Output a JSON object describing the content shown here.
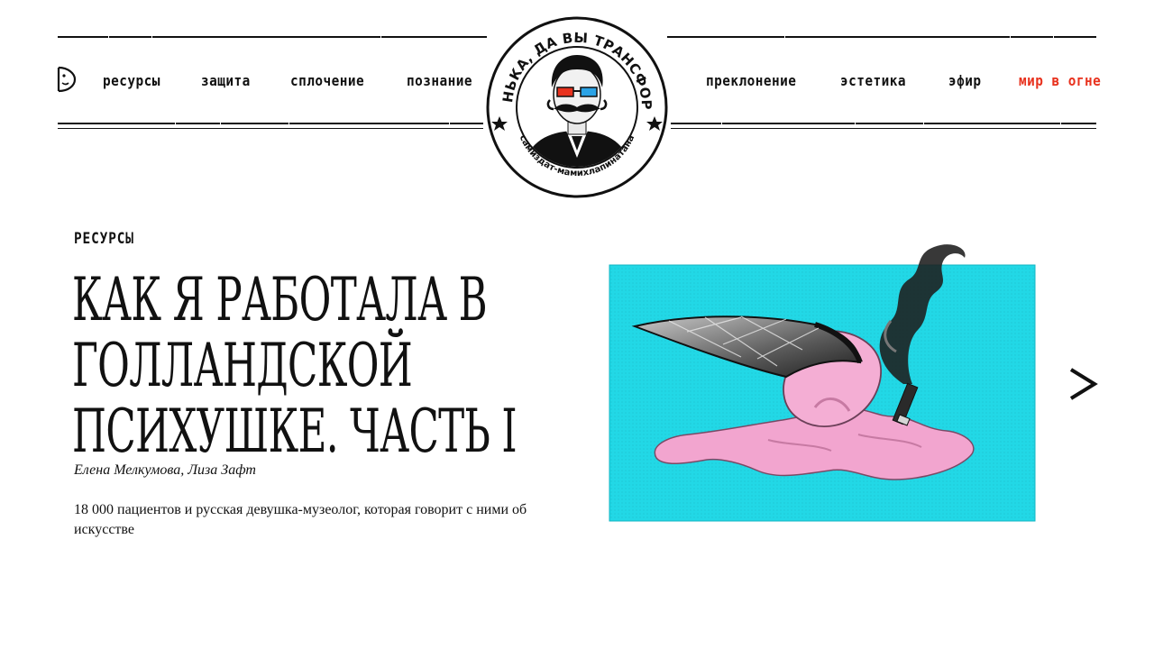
{
  "site": {
    "logo": {
      "ring_text": "БАТЕНЬКА, ДА ВЫ ТРАНСФОРМЕР",
      "bottom_text": "самиздат-мамихлапинатана",
      "icon": "mustached-man-3d-glasses-icon"
    },
    "side_icon": "half-face-icon"
  },
  "nav": {
    "left": [
      {
        "label": "ресурсы"
      },
      {
        "label": "защита"
      },
      {
        "label": "сплочение"
      },
      {
        "label": "познание"
      }
    ],
    "right": [
      {
        "label": "преклонение"
      },
      {
        "label": "эстетика"
      },
      {
        "label": "эфир"
      },
      {
        "label": "мир в огне"
      }
    ],
    "highlight_color": "#e8321e"
  },
  "article": {
    "rubric": "ресурсы",
    "title": "Как я работала в голландской психушке. Часть I",
    "authors": "Елена Мелкумова, Лиза Зафт",
    "lead": "18 000 пациентов и русская девушка-музеолог, которая говорит с ними об искусстве",
    "illustration": {
      "icon": "melting-ice-cream-cone-cigarette-illustration",
      "background_color": "#22d8e6",
      "accent_color": "#f2a5cf"
    },
    "next_icon": "next-arrow-icon"
  }
}
